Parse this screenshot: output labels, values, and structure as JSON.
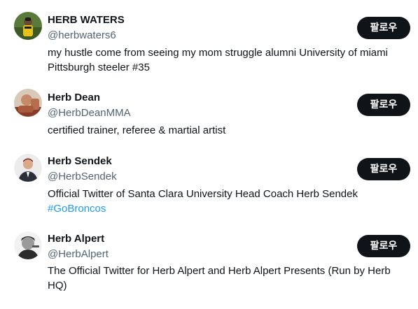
{
  "follow_label": "팔로우",
  "accent_color": "#1d9bf0",
  "users": [
    {
      "display_name": "HERB WATERS",
      "handle": "@herbwaters6",
      "bio_line1": "my hustle come from seeing my mom struggle alumni University of miami",
      "bio_line2": "Pittsburgh steeler #35"
    },
    {
      "display_name": "Herb Dean",
      "handle": "@HerbDeanMMA",
      "bio_line1": "certified trainer, referee & martial artist"
    },
    {
      "display_name": "Herb Sendek",
      "handle": "@HerbSendek",
      "bio_line1": "Official Twitter of Santa Clara University Head Coach Herb Sendek",
      "hashtag": "#GoBroncos"
    },
    {
      "display_name": "Herb Alpert",
      "handle": "@HerbAlpert",
      "bio_line1": "The Official Twitter for Herb Alpert and Herb Alpert Presents (Run by Herb",
      "bio_line2": "HQ)"
    }
  ]
}
